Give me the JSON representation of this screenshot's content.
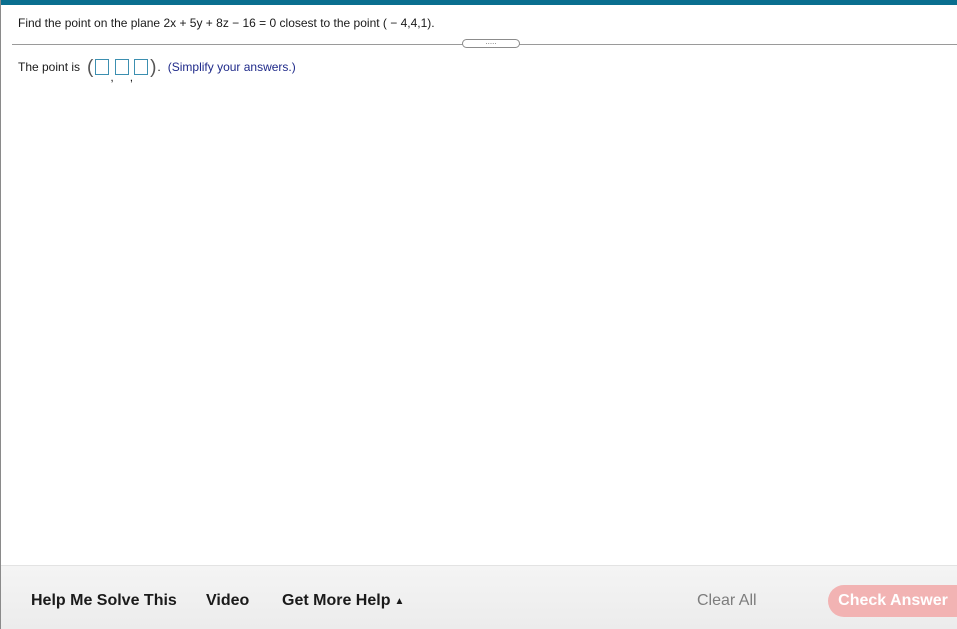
{
  "question": {
    "text": "Find the point on the plane 2x + 5y + 8z − 16 = 0 closest to the point ( − 4,4,1)."
  },
  "expand_button": {
    "label": "....."
  },
  "answer": {
    "prefix": "The point is",
    "open_paren": "(",
    "separator": ",",
    "close_paren": ")",
    "after_paren": ".",
    "hint": "(Simplify your answers.)",
    "inputs": [
      "",
      "",
      ""
    ]
  },
  "footer": {
    "help_solve_label": "Help Me Solve This",
    "video_label": "Video",
    "more_help_label": "Get More Help",
    "more_help_icon": "caret-up-icon",
    "clear_all_label": "Clear All",
    "check_answer_label": "Check Answer"
  },
  "colors": {
    "top_bar": "#0a6f8f",
    "input_border": "#3c8fb0",
    "hint_text": "#1f2a8a",
    "check_answer_bg": "#f2b3b3"
  }
}
